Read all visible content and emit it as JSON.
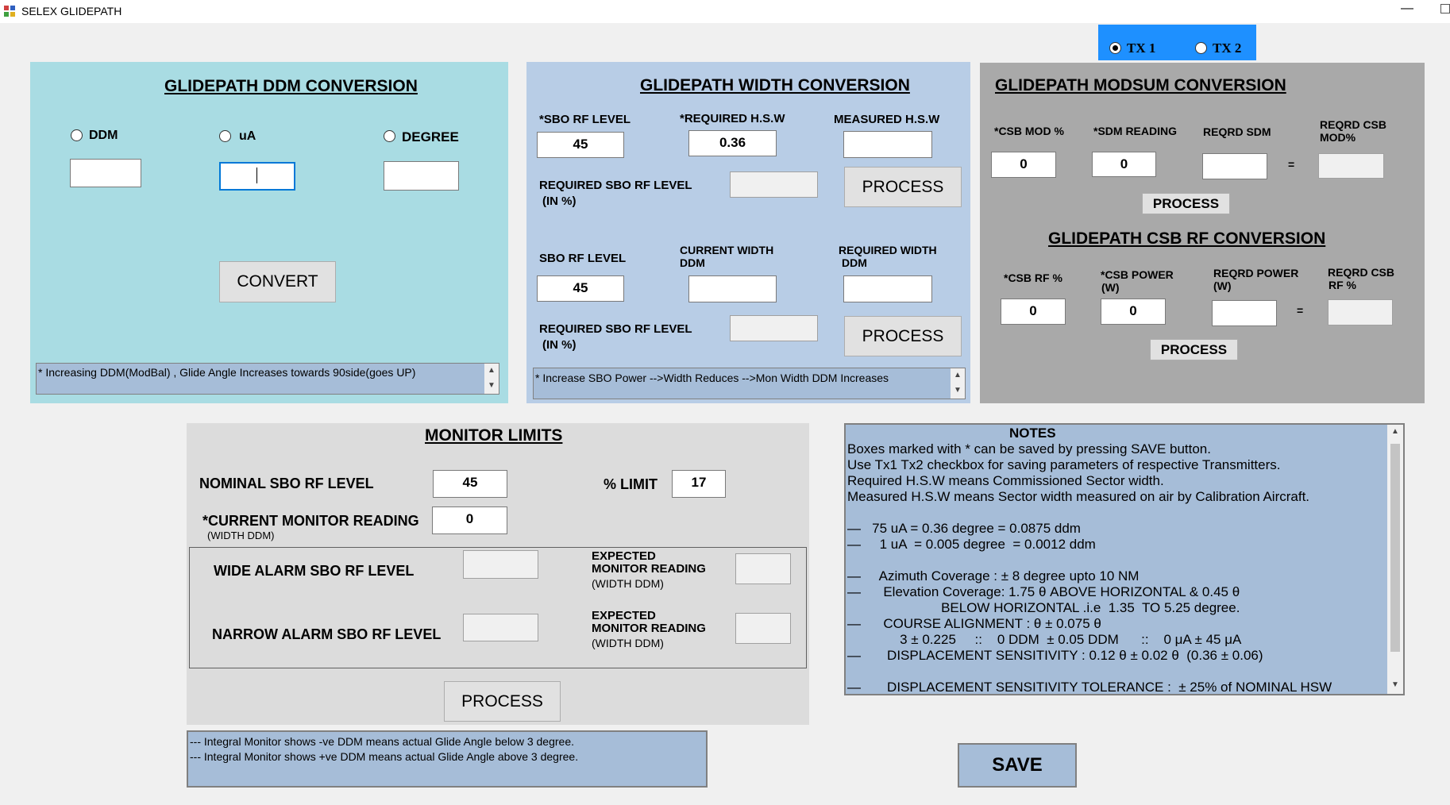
{
  "window": {
    "title": "SELEX GLIDEPATH",
    "minimize": "—"
  },
  "tx": {
    "tx1": "TX 1",
    "tx2": "TX 2",
    "selected": "tx1"
  },
  "ddm_panel": {
    "title": "GLIDEPATH DDM CONVERSION",
    "radio_ddm": "DDM",
    "radio_ua": "uA",
    "radio_degree": "DEGREE",
    "ddm_value": "",
    "ua_value": "",
    "degree_value": "",
    "convert_label": "CONVERT",
    "note": "*  Increasing DDM(ModBal) , Glide Angle Increases towards 90side(goes UP)"
  },
  "width_panel": {
    "title": "GLIDEPATH WIDTH CONVERSION",
    "sbo_rf_label": "*SBO RF LEVEL",
    "sbo_rf_value": "45",
    "req_hsw_label": "*REQUIRED H.S.W",
    "req_hsw_value": "0.36",
    "meas_hsw_label": "MEASURED H.S.W",
    "meas_hsw_value": "",
    "req_sbo_label_1": "REQUIRED SBO RF LEVEL",
    "req_sbo_label_2": "(IN %)",
    "req_sbo_value": "",
    "process1_label": "PROCESS",
    "sbo_rf2_label": "SBO RF LEVEL",
    "sbo_rf2_value": "45",
    "cur_width_label_1": "CURRENT WIDTH",
    "cur_width_label_2": "DDM",
    "cur_width_value": "",
    "req_width_label_1": "REQUIRED WIDTH",
    "req_width_label_2": "DDM",
    "req_width_value": "",
    "req_sbo2_label_1": "REQUIRED SBO RF LEVEL",
    "req_sbo2_label_2": "(IN %)",
    "req_sbo2_value": "",
    "process2_label": "PROCESS",
    "note": "*  Increase SBO Power  -->Width Reduces -->Mon Width DDM Increases"
  },
  "modsum_panel": {
    "title": "GLIDEPATH MODSUM CONVERSION",
    "csb_mod_label": "*CSB MOD %",
    "csb_mod_value": "0",
    "sdm_reading_label": "*SDM READING",
    "sdm_reading_value": "0",
    "reqrd_sdm_label": "REQRD SDM",
    "reqrd_sdm_value": "",
    "equals": "=",
    "reqrd_csb_mod_label_1": "REQRD CSB",
    "reqrd_csb_mod_label_2": "MOD%",
    "reqrd_csb_mod_value": "",
    "process_label": "PROCESS"
  },
  "csbrf_panel": {
    "title": "GLIDEPATH CSB RF CONVERSION",
    "csb_rf_label": "*CSB RF %",
    "csb_rf_value": "0",
    "csb_power_label_1": "*CSB POWER",
    "csb_power_label_2": "(W)",
    "csb_power_value": "0",
    "reqrd_power_label_1": "REQRD POWER",
    "reqrd_power_label_2": "(W)",
    "reqrd_power_value": "",
    "equals": "=",
    "reqrd_csb_rf_label_1": "REQRD CSB",
    "reqrd_csb_rf_label_2": "RF %",
    "reqrd_csb_rf_value": "",
    "process_label": "PROCESS"
  },
  "monitor_panel": {
    "title": "MONITOR LIMITS",
    "nominal_label": "NOMINAL SBO RF LEVEL",
    "nominal_value": "45",
    "limit_label": "% LIMIT",
    "limit_value": "17",
    "current_label": "*CURRENT MONITOR READING",
    "current_sub": "(WIDTH DDM)",
    "current_value": "0",
    "wide_label": "WIDE ALARM SBO RF LEVEL",
    "wide_value": "",
    "narrow_label": "NARROW ALARM SBO RF LEVEL",
    "narrow_value": "",
    "expected_label_1": "EXPECTED",
    "expected_label_2": "MONITOR READING",
    "expected_sub": "(WIDTH DDM)",
    "expected_wide_value": "",
    "expected_narrow_value": "",
    "process_label": "PROCESS"
  },
  "integral_note": {
    "line1": "---   Integral Monitor shows -ve DDM means actual Glide Angle below 3 degree.",
    "line2": "---   Integral Monitor shows +ve DDM means actual Glide Angle above 3 degree."
  },
  "notes": {
    "title": "NOTES",
    "lines": [
      "Boxes marked with * can be saved by pressing SAVE button.",
      "Use Tx1 Tx2 checkbox for saving parameters of respective Transmitters.",
      "Required H.S.W means Commissioned Sector width.",
      "Measured H.S.W means Sector width measured on air by Calibration Aircraft.",
      "",
      "—   75 uA = 0.36 degree = 0.0875 ddm",
      "—     1 uA  = 0.005 degree  = 0.0012 ddm",
      "",
      "—     Azimuth Coverage : ± 8 degree upto 10 NM",
      "—      Elevation Coverage: 1.75 θ ABOVE HORIZONTAL & 0.45 θ",
      "                         BELOW HORIZONTAL .i.e  1.35  TO 5.25 degree.",
      "—      COURSE ALIGNMENT : θ ± 0.075 θ",
      "              3 ± 0.225     ::    0 DDM  ± 0.05 DDM      ::    0 μA ± 45 μA",
      "—       DISPLACEMENT SENSITIVITY : 0.12 θ ± 0.02 θ  (0.36 ± 0.06)",
      "",
      "—       DISPLACEMENT SENSITIVITY TOLERANCE :  ± 25% of NOMINAL HSW"
    ]
  },
  "save_label": "SAVE"
}
